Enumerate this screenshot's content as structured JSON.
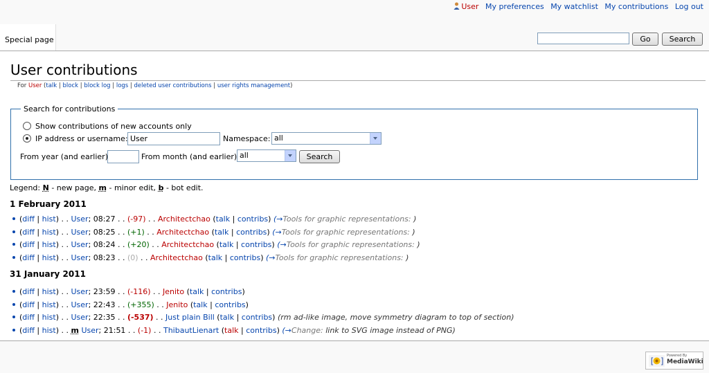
{
  "personal_tools": {
    "user": "User",
    "preferences": "My preferences",
    "watchlist": "My watchlist",
    "contributions": "My contributions",
    "logout": "Log out"
  },
  "tabs": {
    "special": "Special page"
  },
  "search": {
    "go": "Go",
    "search": "Search",
    "value": ""
  },
  "page": {
    "title": "User contributions",
    "sub_for": "For",
    "sub_user": "User",
    "sub_links": [
      "talk",
      "block",
      "block log",
      "logs",
      "deleted user contributions",
      "user rights management"
    ]
  },
  "form": {
    "legend": "Search for contributions",
    "radio_new": "Show contributions of new accounts only",
    "radio_ip": "IP address or username:",
    "username_value": "User",
    "namespace_label": "Namespace:",
    "namespace_value": "all",
    "year_label": "From year (and earlier):",
    "year_value": "",
    "month_label": "From month (and earlier):",
    "month_value": "all",
    "submit": "Search"
  },
  "legend_line": {
    "prefix": "Legend:",
    "n": "N",
    "n_text": "- new page,",
    "m": "m",
    "m_text": "- minor edit,",
    "b": "b",
    "b_text": "- bot edit."
  },
  "days": [
    {
      "date": "1 February 2011",
      "entries": [
        {
          "diff": "diff",
          "hist": "hist",
          "page": "User",
          "time": "08:27",
          "change": "(-97)",
          "change_class": "red",
          "user": "Architectchao",
          "talk": "talk",
          "contribs": "contribs",
          "arrow": "(→",
          "section": "Tools for graphic representations:",
          "comment_rest": ")",
          "minor": ""
        },
        {
          "diff": "diff",
          "hist": "hist",
          "page": "User",
          "time": "08:25",
          "change": "(+1)",
          "change_class": "green",
          "user": "Architectchao",
          "talk": "talk",
          "contribs": "contribs",
          "arrow": "(→",
          "section": "Tools for graphic representations:",
          "comment_rest": ")",
          "minor": ""
        },
        {
          "diff": "diff",
          "hist": "hist",
          "page": "User",
          "time": "08:24",
          "change": "(+20)",
          "change_class": "green",
          "user": "Architectchao",
          "talk": "talk",
          "contribs": "contribs",
          "arrow": "(→",
          "section": "Tools for graphic representations:",
          "comment_rest": ")",
          "minor": ""
        },
        {
          "diff": "diff",
          "hist": "hist",
          "page": "User",
          "time": "08:23",
          "change": "(0)",
          "change_class": "grey",
          "user": "Architectchao",
          "talk": "talk",
          "contribs": "contribs",
          "arrow": "(→",
          "section": "Tools for graphic representations:",
          "comment_rest": ")",
          "minor": ""
        }
      ]
    },
    {
      "date": "31 January 2011",
      "entries": [
        {
          "diff": "diff",
          "hist": "hist",
          "page": "User",
          "time": "23:59",
          "change": "(-116)",
          "change_class": "red",
          "user": "Jenito",
          "talk": "talk",
          "contribs": "contribs",
          "arrow": "",
          "section": "",
          "comment_rest": "",
          "minor": ""
        },
        {
          "diff": "diff",
          "hist": "hist",
          "page": "User",
          "time": "22:43",
          "change": "(+355)",
          "change_class": "green",
          "user": "Jenito",
          "talk": "talk",
          "contribs": "contribs",
          "arrow": "",
          "section": "",
          "comment_rest": "",
          "minor": ""
        },
        {
          "diff": "diff",
          "hist": "hist",
          "page": "User",
          "time": "22:35",
          "change": "(-537)",
          "change_class": "red bold",
          "user": "Just plain Bill",
          "talk": "talk",
          "contribs": "contribs",
          "arrow": "",
          "section": "",
          "comment_rest": "(rm ad-like image, move symmetry diagram to top of section)",
          "minor": ""
        },
        {
          "diff": "diff",
          "hist": "hist",
          "page": "User",
          "time": "21:51",
          "change": "(-1)",
          "change_class": "red",
          "user": "ThibautLienart",
          "talk": "talk",
          "contribs": "contribs",
          "arrow": "(→",
          "section": "Change:",
          "comment_rest": " link to SVG image instead of PNG)",
          "minor": "m"
        }
      ]
    }
  ],
  "footer": {
    "powered_small": "Powered By",
    "powered_big": "MediaWiki"
  },
  "colors": {
    "link": "#0645ad",
    "red_link": "#ba0000",
    "positive": "#006400",
    "zero": "#aaaaaa",
    "border": "#2f6fab"
  }
}
